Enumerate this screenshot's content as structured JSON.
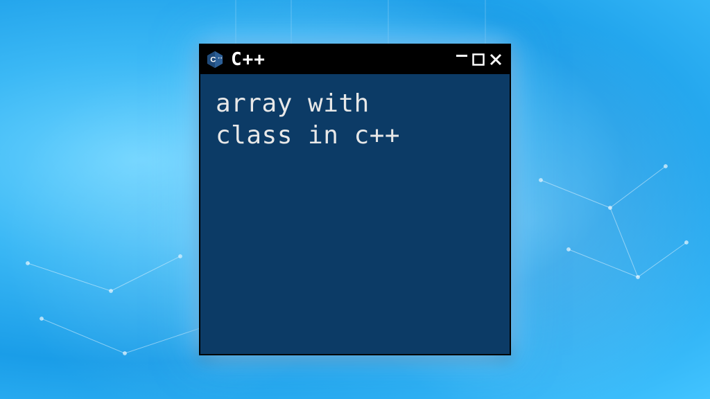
{
  "window": {
    "title": "C++",
    "logo_name": "cpp-logo"
  },
  "content": {
    "text": "array with\nclass in c++"
  },
  "controls": {
    "minimize": "−",
    "maximize": "□",
    "close": "×"
  },
  "colors": {
    "titlebar_bg": "#000000",
    "content_bg": "#0c3b66",
    "text": "#e8e8e8",
    "glow": "#78c8ff"
  }
}
